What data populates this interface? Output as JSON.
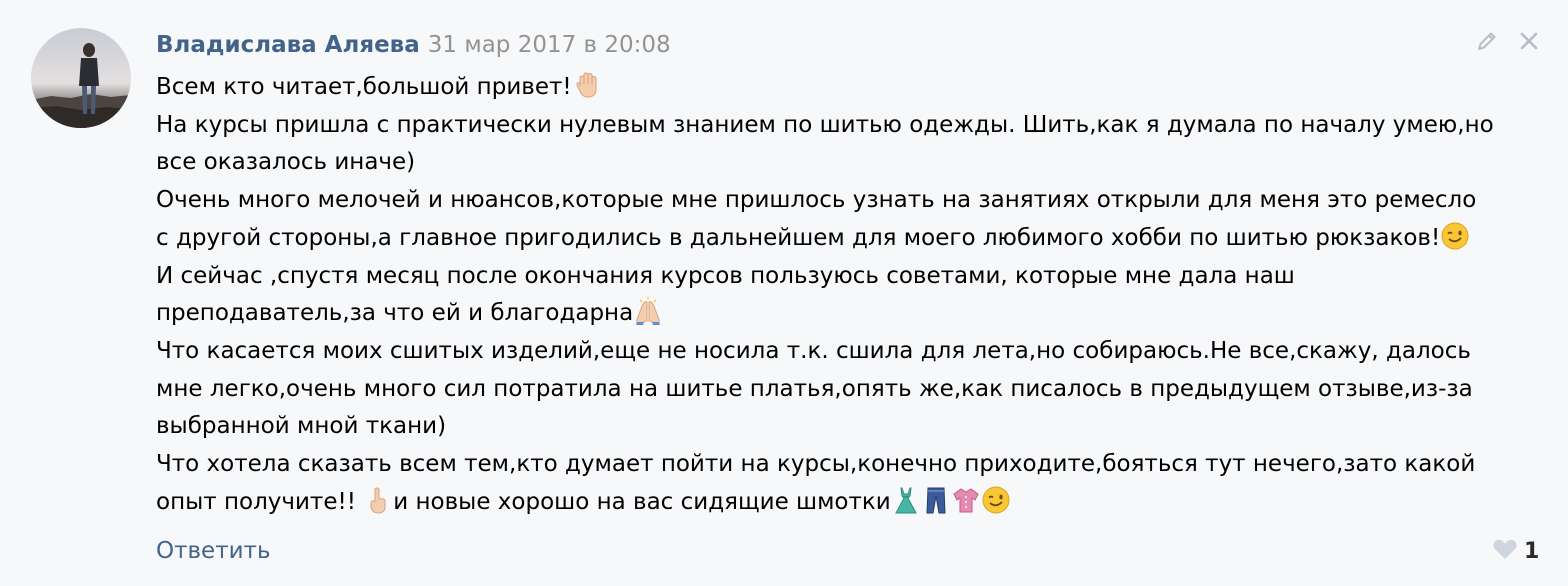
{
  "comment": {
    "author": "Владислава Аляева",
    "date": "31 мар 2017 в 20:08",
    "lines": [
      "Всем кто читает,большой привет!",
      "На курсы пришла с практически нулевым знанием по шитью одежды. Шить,как я думала по началу умею,но",
      "все оказалось иначе)",
      "Очень много мелочей и нюансов,которые мне пришлось узнать на занятиях открыли для меня это ремесло",
      "с другой стороны,а главное пригодились в дальнейшем для моего любимого хобби по шитью рюкзаков!",
      "И сейчас ,спустя месяц после окончания курсов пользуюсь советами, которые мне дала наш",
      "преподаватель,за что ей и благодарна",
      "Что касается моих сшитых изделий,еще не носила т.к. сшила для лета,но собираюсь.Не все,скажу, далось",
      "мне легко,очень много сил потратила на шитье платья,опять же,как писалось в предыдущем отзыве,из-за",
      "выбранной мной ткани)",
      "Что хотела сказать всем тем,кто думает пойти на курсы,конечно приходите,бояться тут нечего,зато какой",
      "опыт получите!!",
      "и новые хорошо на вас сидящие шмотки"
    ],
    "reply_label": "Ответить",
    "likes": "1"
  },
  "colors": {
    "background": "#f7f8fa",
    "author": "#42648b",
    "date": "#939393",
    "link": "#42648b"
  },
  "icons": {
    "edit": "pencil-icon",
    "delete": "close-icon",
    "like": "heart-icon",
    "emoji": [
      "raised-hand-emoji",
      "winking-face-emoji",
      "folded-hands-emoji",
      "pointing-up-emoji",
      "dress-emoji",
      "jeans-emoji",
      "blouse-emoji",
      "winking-face-emoji"
    ]
  }
}
